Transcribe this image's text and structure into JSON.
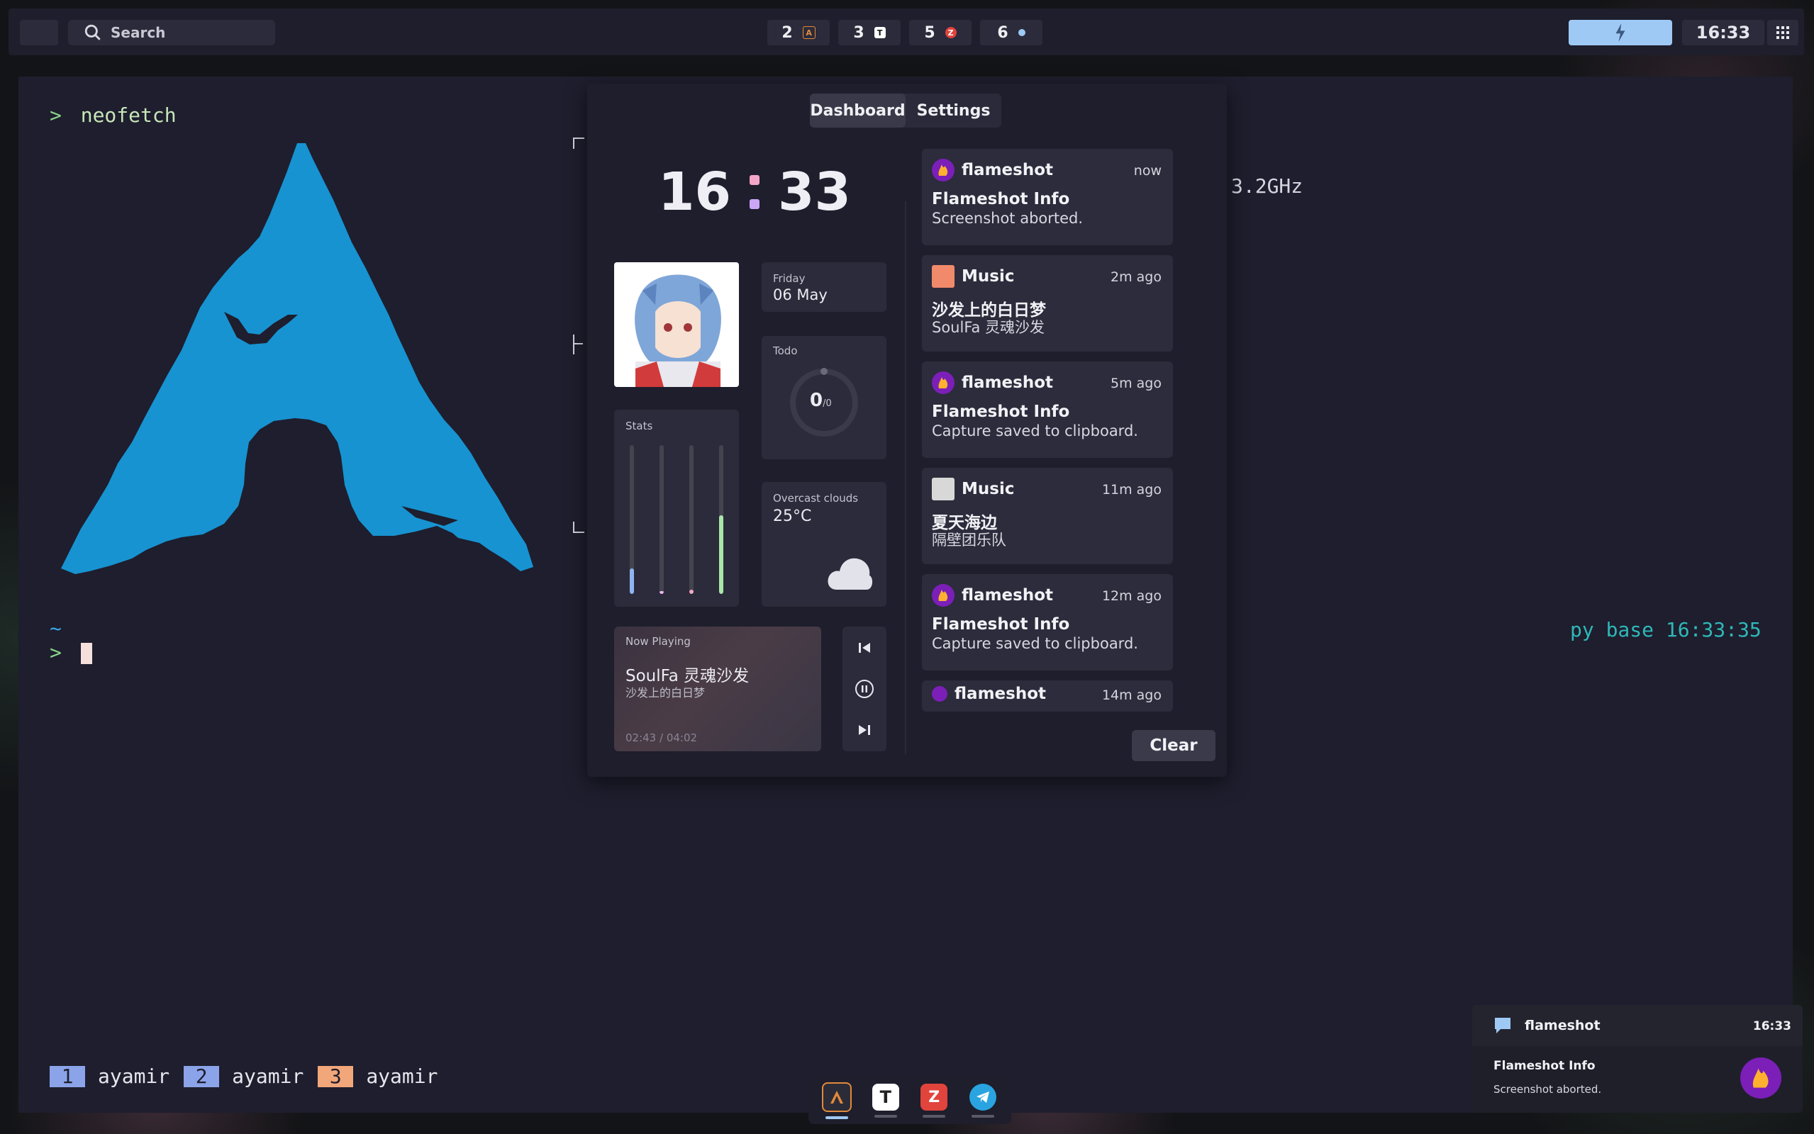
{
  "topbar": {
    "search_placeholder": "Search",
    "workspaces": [
      {
        "number": "2",
        "icon": "alacritty-icon",
        "icon_color": "#e38a3a"
      },
      {
        "number": "3",
        "icon": "typora-icon",
        "icon_color": "#ffffff"
      },
      {
        "number": "5",
        "icon": "zotero-icon",
        "icon_color": "#e0443c"
      },
      {
        "number": "6",
        "icon": "settings-dot-icon",
        "icon_color": "#9fc9f5"
      }
    ],
    "battery_icon": "lightning-icon",
    "time": "16:33",
    "grid_icon": "apps-grid-icon"
  },
  "terminal": {
    "prompt_symbol": ">",
    "command": "neofetch",
    "cpu_text": "3.2GHz",
    "cwd": "~",
    "right_prompt": "py base 16:33:35",
    "workspace_tags": [
      {
        "num": "1",
        "name": "ayamir",
        "color": "#8ba3e8"
      },
      {
        "num": "2",
        "name": "ayamir",
        "color": "#8ba3e8"
      },
      {
        "num": "3",
        "name": "ayamir",
        "color": "#f2a77a"
      }
    ]
  },
  "dashboard": {
    "tabs": [
      "Dashboard",
      "Settings"
    ],
    "active_tab": "Dashboard",
    "clock": {
      "hours": "16",
      "minutes": "33"
    },
    "date": {
      "weekday": "Friday",
      "day": "06 May"
    },
    "todo": {
      "label": "Todo",
      "done": "0",
      "total": "/0"
    },
    "stats": {
      "label": "Stats",
      "levels": [
        0.17,
        0.02,
        0.03,
        0.53
      ],
      "colors": [
        "#8fb4f0",
        "#f0b6f0",
        "#f5a8c4",
        "#a9e6a9"
      ]
    },
    "weather": {
      "condition": "Overcast clouds",
      "temp": "25°C"
    },
    "now_playing": {
      "label": "Now Playing",
      "title": "SoulFa 灵魂沙发",
      "subtitle": "沙发上的白日梦",
      "progress": "02:43 / 04:02"
    },
    "notifications": [
      {
        "app": "flameshot",
        "time": "now",
        "title": "Flameshot Info",
        "body": "Screenshot aborted."
      },
      {
        "app": "Music",
        "time": "2m ago",
        "title": "沙发上的白日梦",
        "body": "SoulFa 灵魂沙发"
      },
      {
        "app": "flameshot",
        "time": "5m ago",
        "title": "Flameshot Info",
        "body": "Capture saved to clipboard."
      },
      {
        "app": "Music",
        "time": "11m ago",
        "title": "夏天海边",
        "body": "隔壁团乐队"
      },
      {
        "app": "flameshot",
        "time": "12m ago",
        "title": "Flameshot Info",
        "body": "Capture saved to clipboard."
      },
      {
        "app": "flameshot",
        "time": "14m ago",
        "title": "",
        "body": ""
      }
    ],
    "clear_label": "Clear"
  },
  "dock": {
    "apps": [
      "alacritty-icon",
      "typora-icon",
      "zotero-icon",
      "telegram-icon"
    ]
  },
  "toast": {
    "app": "flameshot",
    "time": "16:33",
    "title": "Flameshot Info",
    "body": "Screenshot aborted."
  }
}
